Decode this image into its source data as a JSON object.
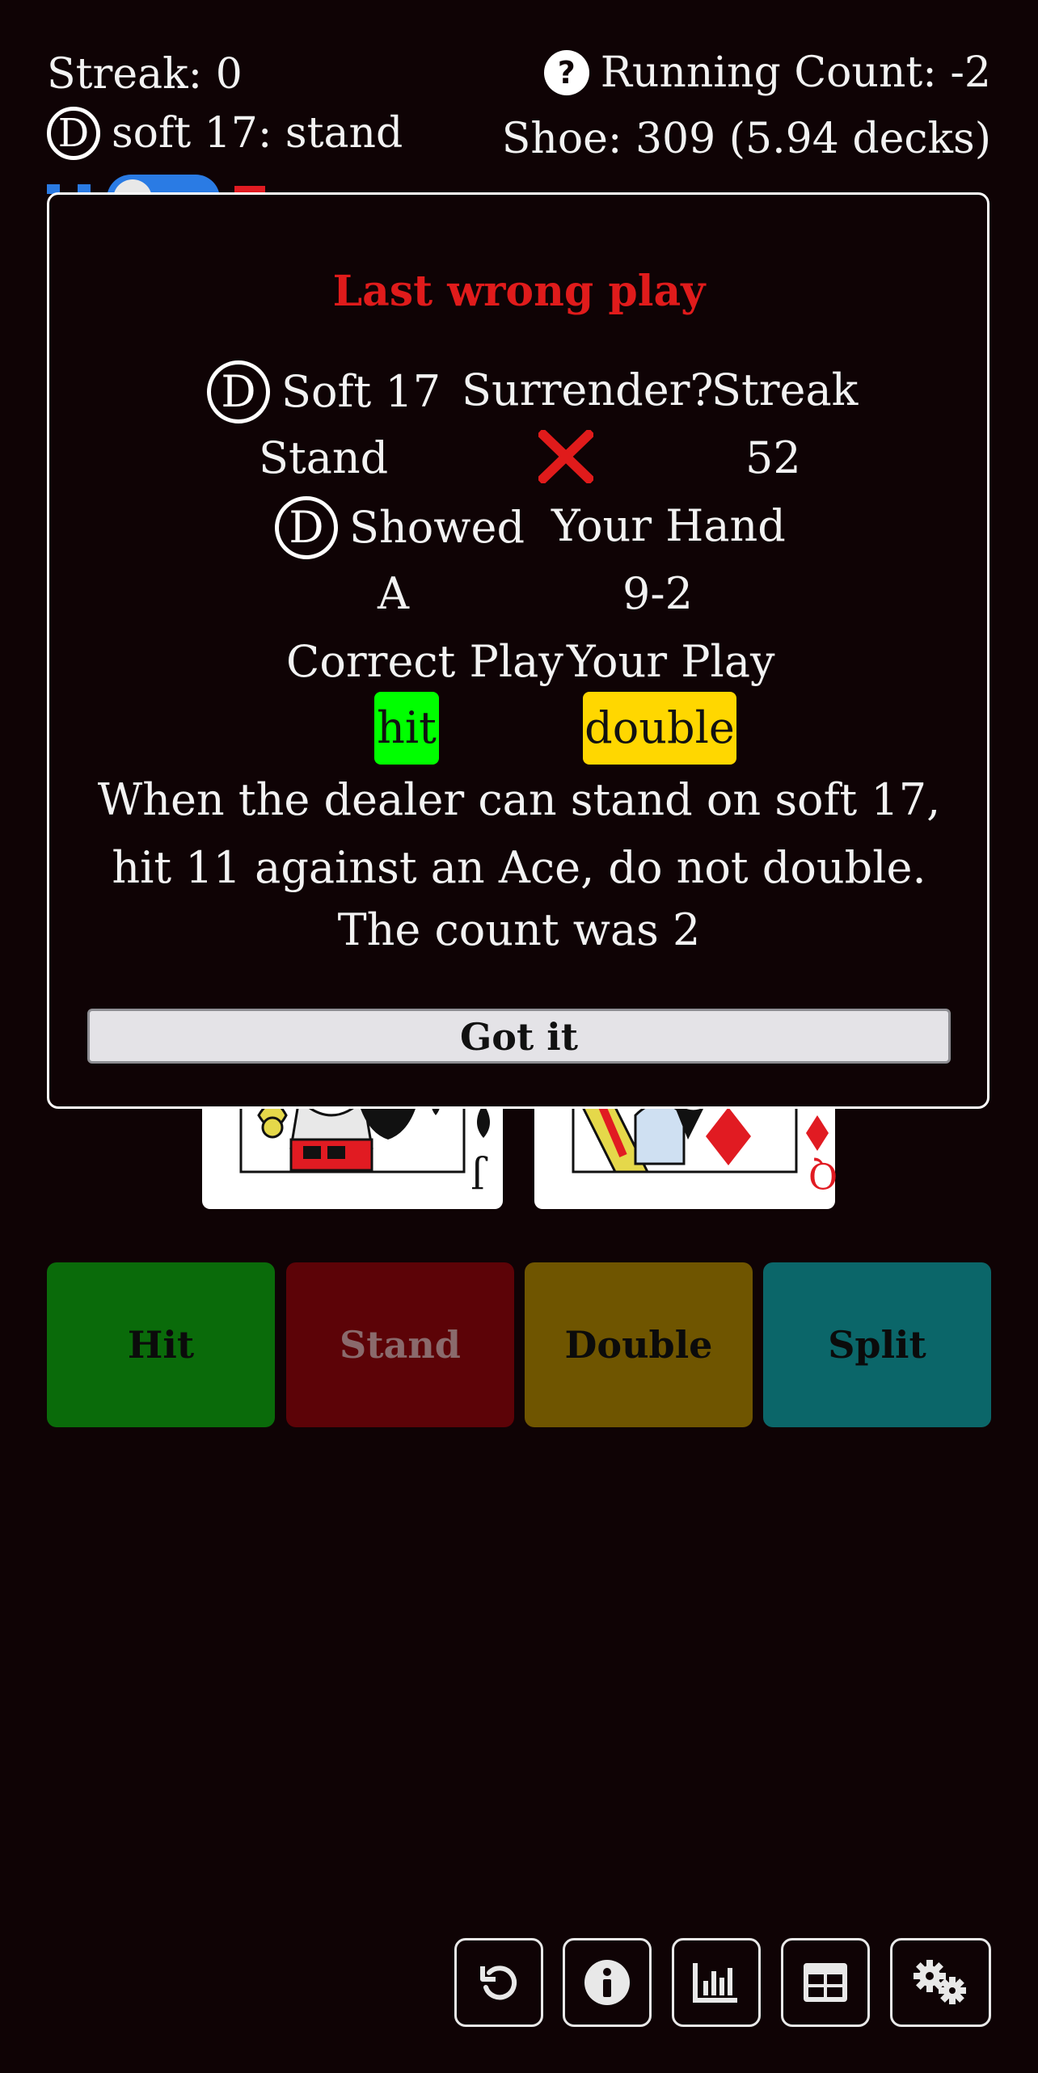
{
  "header": {
    "streak_label": "Streak: 0",
    "dealer_badge": "D",
    "soft17_label": "soft 17: stand",
    "running_count_label": "Running Count: -2",
    "shoe_label": "Shoe: 309 (5.94 decks)",
    "help_icon": "question-circle-icon"
  },
  "modal": {
    "title": "Last wrong play",
    "dealer_badge": "D",
    "soft17_header": "Soft 17",
    "surrender_header": "Surrender?",
    "streak_header": "Streak",
    "soft17_value": "Stand",
    "surrender_value_icon": "x-mark-icon",
    "streak_value": "52",
    "showed_header": "Showed",
    "hand_header": "Your Hand",
    "showed_value": "A",
    "hand_value": "9-2",
    "correct_header": "Correct Play",
    "your_play_header": "Your Play",
    "correct_value": "hit",
    "your_play_value": "double",
    "explanation": "When the dealer can stand on soft 17, hit 11 against an Ace, do not double.",
    "count_note": "The count was 2",
    "got_it_label": "Got it"
  },
  "cards": [
    {
      "rank": "J",
      "suit": "♠",
      "color": "#111111"
    },
    {
      "rank": "Q",
      "suit": "♦",
      "color": "#e11b22"
    }
  ],
  "actions": [
    {
      "label": "Hit",
      "color": "#0a6b0a"
    },
    {
      "label": "Stand",
      "color": "#5c0307"
    },
    {
      "label": "Double",
      "color": "#6f5500"
    },
    {
      "label": "Split",
      "color": "#0b6669"
    }
  ],
  "toolbar": [
    {
      "icon": "undo-icon"
    },
    {
      "icon": "info-icon"
    },
    {
      "icon": "bar-chart-icon"
    },
    {
      "icon": "table-icon"
    },
    {
      "icon": "settings-gears-icon"
    }
  ],
  "colors": {
    "background": "#0f0305",
    "title_red": "#e01b1b",
    "correct_green": "#00ff00",
    "your_play_yellow": "#ffd700"
  }
}
